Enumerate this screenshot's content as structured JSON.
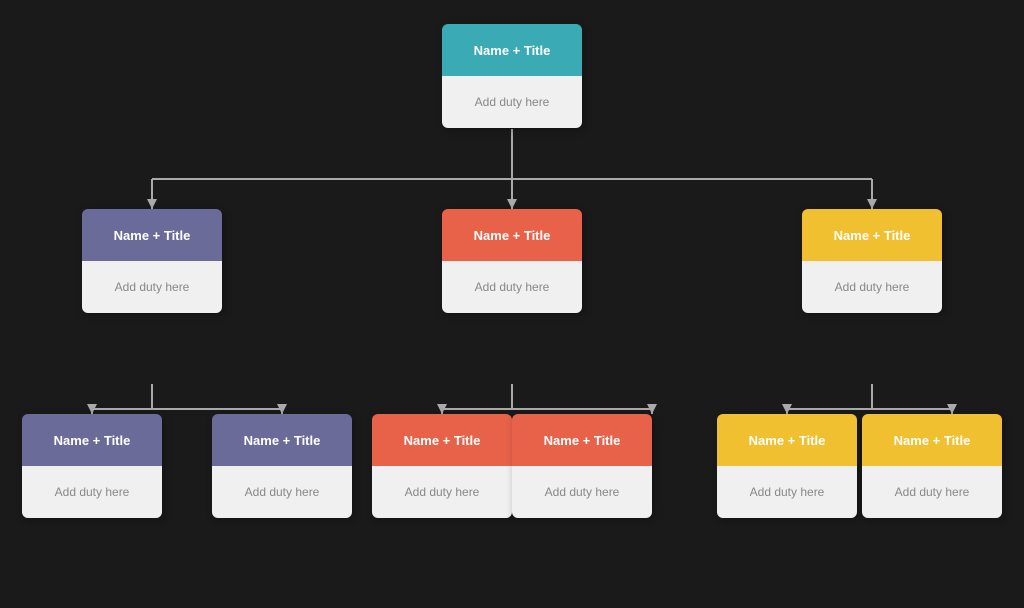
{
  "colors": {
    "teal": "#3aabb5",
    "purple": "#6b6b9a",
    "coral": "#e8624a",
    "yellow": "#f0c030",
    "connector": "#aaaaaa",
    "node_body_bg": "#f0f0f0",
    "node_body_text": "#999999"
  },
  "nodes": {
    "root": {
      "header": "Name + Title",
      "body": "Add duty here",
      "color": "teal"
    },
    "left": {
      "header": "Name + Title",
      "body": "Add duty here",
      "color": "purple"
    },
    "center": {
      "header": "Name + Title",
      "body": "Add duty here",
      "color": "coral"
    },
    "right": {
      "header": "Name + Title",
      "body": "Add duty here",
      "color": "yellow"
    },
    "left_left": {
      "header": "Name + Title",
      "body": "Add duty here",
      "color": "purple"
    },
    "left_right": {
      "header": "Name + Title",
      "body": "Add duty here",
      "color": "purple"
    },
    "center_left": {
      "header": "Name + Title",
      "body": "Add duty here",
      "color": "coral"
    },
    "center_right": {
      "header": "Name + Title",
      "body": "Add duty here",
      "color": "coral"
    },
    "right_left": {
      "header": "Name + Title",
      "body": "Add duty here",
      "color": "yellow"
    },
    "right_right": {
      "header": "Name + Title",
      "body": "Add duty here",
      "color": "yellow"
    }
  }
}
